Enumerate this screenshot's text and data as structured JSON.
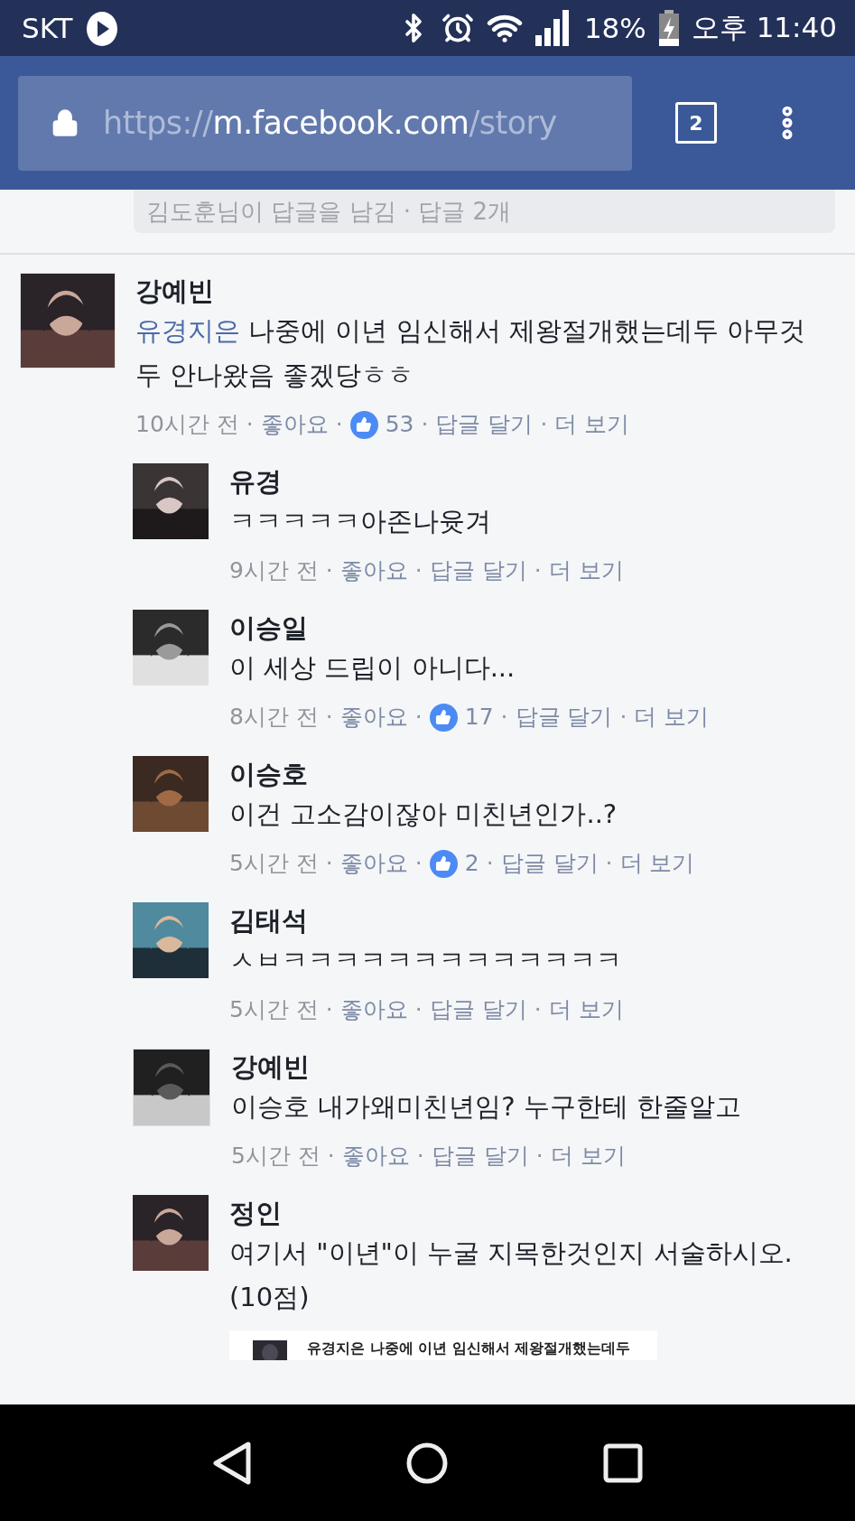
{
  "status_bar": {
    "carrier": "SKT",
    "battery": "18%",
    "time": "오후 11:40"
  },
  "browser": {
    "url_scheme": "https://",
    "url_host": "m.facebook.com",
    "url_path": "/story",
    "tab_count": "2"
  },
  "separator": "·",
  "previous_replies": "김도훈님이 답글을 남김 · 답글 2개",
  "comment": {
    "author": "강예빈",
    "mention": "유경지은",
    "text": "나중에 이년 임신해서 제왕절개했는데두 아무것두 안나왔음 좋겠당ㅎㅎ",
    "time": "10시간 전",
    "like": "좋아요",
    "reactions": "53",
    "reply": "답글 달기",
    "more": "더 보기"
  },
  "replies": [
    {
      "author": "유경",
      "text": "ㅋㅋㅋㅋㅋ아존나윳겨",
      "time": "9시간 전",
      "like": "좋아요",
      "reply": "답글 달기",
      "more": "더 보기"
    },
    {
      "author": "이승일",
      "text": "이 세상 드립이 아니다...",
      "time": "8시간 전",
      "like": "좋아요",
      "reactions": "17",
      "reply": "답글 달기",
      "more": "더 보기"
    },
    {
      "author": "이승호",
      "text": "이건 고소감이잖아 미친년인가..?",
      "time": "5시간 전",
      "like": "좋아요",
      "reactions": "2",
      "reply": "답글 달기",
      "more": "더 보기"
    },
    {
      "author": "김태석",
      "text": "ㅅㅂㅋㅋㅋㅋㅋㅋㅋㅋㅋㅋㅋㅋㅋ",
      "time": "5시간 전",
      "like": "좋아요",
      "reply": "답글 달기",
      "more": "더 보기"
    },
    {
      "author": "강예빈",
      "text": "이승호 내가왜미친년임? 누구한테 한줄알고",
      "time": "5시간 전",
      "like": "좋아요",
      "reply": "답글 달기",
      "more": "더 보기"
    },
    {
      "author": "정인",
      "text": "여기서 \"이년\"이 누굴 지목한것인지 서술하시오.(10점)",
      "attachment": {
        "text": "유경지은 나중에 이년 임신해서 제왕절개했는데두"
      }
    }
  ]
}
